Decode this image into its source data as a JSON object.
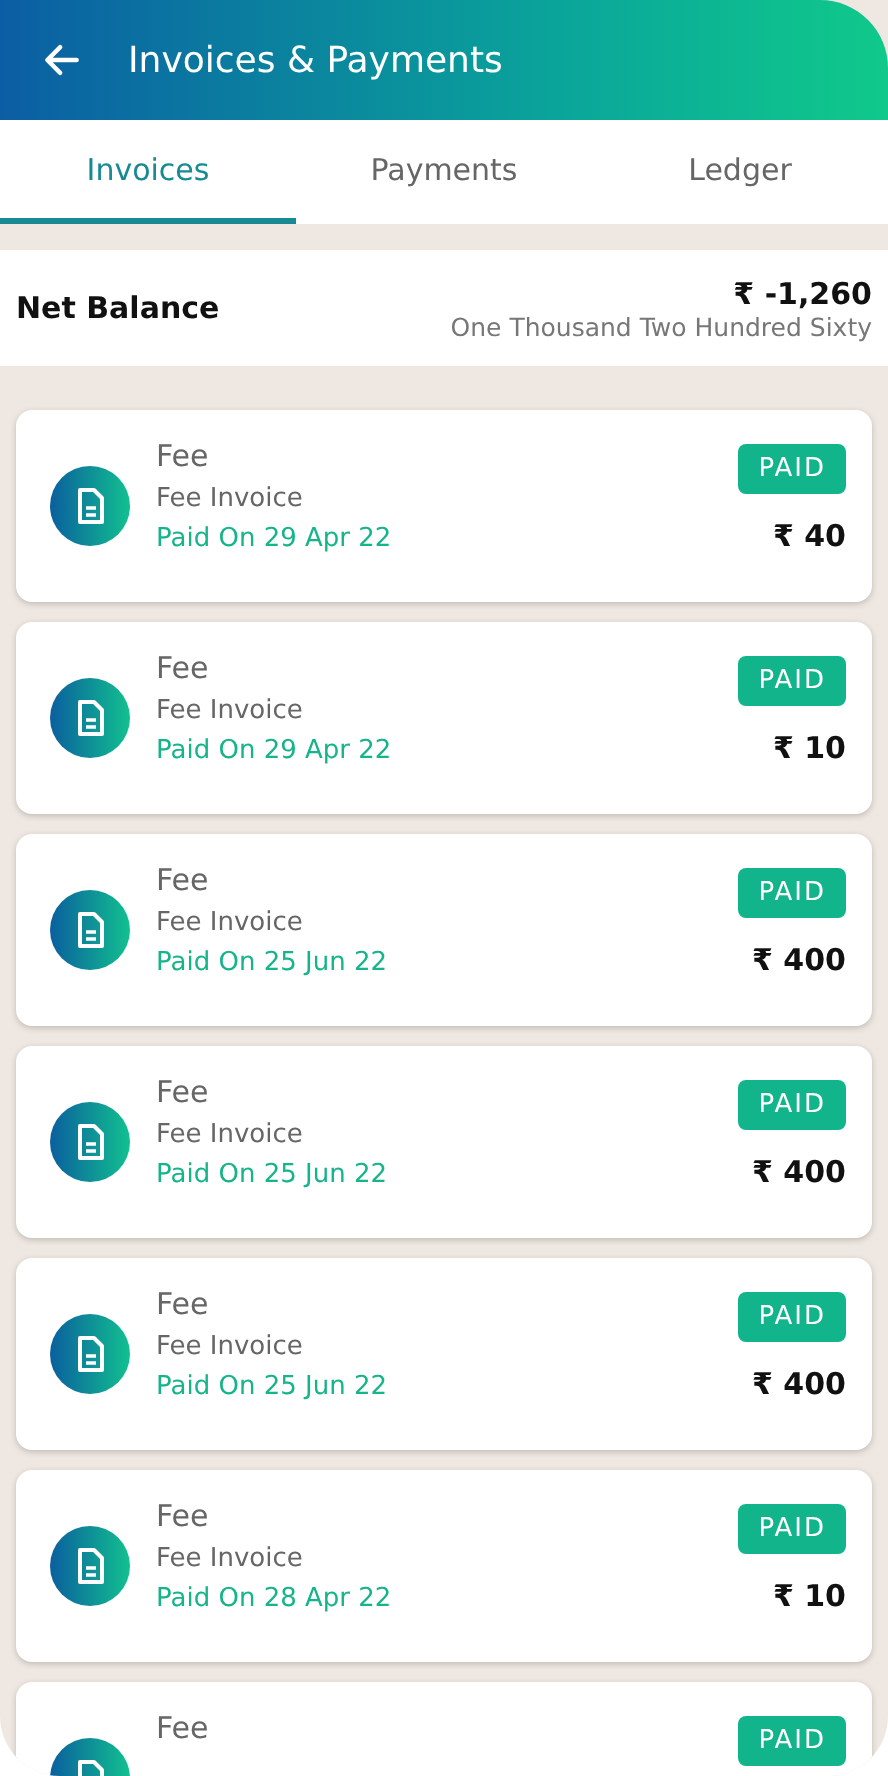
{
  "header": {
    "title": "Invoices & Payments"
  },
  "tabs": [
    {
      "label": "Invoices",
      "selected": true
    },
    {
      "label": "Payments",
      "selected": false
    },
    {
      "label": "Ledger",
      "selected": false
    }
  ],
  "net_balance": {
    "label": "Net Balance",
    "amount": "₹ -1,260",
    "amount_words": "One Thousand Two Hundred Sixty"
  },
  "invoices": [
    {
      "title": "Fee",
      "type": "Fee Invoice",
      "paid_on": "Paid On 29 Apr 22",
      "status": "PAID",
      "amount": "₹ 40"
    },
    {
      "title": "Fee",
      "type": "Fee Invoice",
      "paid_on": "Paid On 29 Apr 22",
      "status": "PAID",
      "amount": "₹ 10"
    },
    {
      "title": "Fee",
      "type": "Fee Invoice",
      "paid_on": "Paid On 25 Jun 22",
      "status": "PAID",
      "amount": "₹ 400"
    },
    {
      "title": "Fee",
      "type": "Fee Invoice",
      "paid_on": "Paid On 25 Jun 22",
      "status": "PAID",
      "amount": "₹ 400"
    },
    {
      "title": "Fee",
      "type": "Fee Invoice",
      "paid_on": "Paid On 25 Jun 22",
      "status": "PAID",
      "amount": "₹ 400"
    },
    {
      "title": "Fee",
      "type": "Fee Invoice",
      "paid_on": "Paid On 28 Apr 22",
      "status": "PAID",
      "amount": "₹ 10"
    },
    {
      "title": "Fee",
      "status": "PAID"
    }
  ]
}
